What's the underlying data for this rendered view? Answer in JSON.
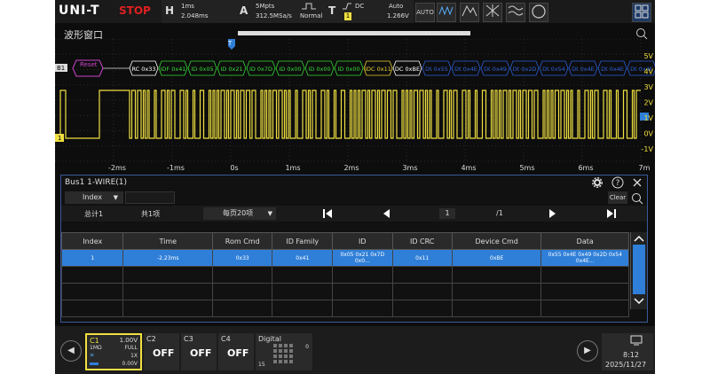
{
  "top": {
    "logo": "UNI-T",
    "status": "STOP",
    "h": {
      "letter": "H",
      "val1": "1ms",
      "val2": "2.048ms"
    },
    "a": {
      "letter": "A",
      "val1": "5Mpts",
      "val2": "312.5MSa/s",
      "mode": "Normal"
    },
    "t": {
      "letter": "T",
      "src": "DC",
      "lvl": "1",
      "mode": "Auto",
      "val": "1.266V"
    },
    "buttons": [
      "AUTO"
    ]
  },
  "wave": {
    "title": "波形窗口",
    "trig_marker": "T",
    "bus_label": "B1",
    "reset_label": "Reset",
    "packets": [
      {
        "text": "RC 0x33",
        "color": "#ffffff"
      },
      {
        "text": "IDF 0x41",
        "color": "#35d835"
      },
      {
        "text": "ID 0x05",
        "color": "#35d835"
      },
      {
        "text": "ID 0x21",
        "color": "#35d835"
      },
      {
        "text": "ID 0x7D",
        "color": "#35d835"
      },
      {
        "text": "ID 0x00",
        "color": "#35d835"
      },
      {
        "text": "ID 0x00",
        "color": "#35d835"
      },
      {
        "text": "ID 0x00",
        "color": "#35d835"
      },
      {
        "text": "IDC 0x11",
        "color": "#e8d030"
      },
      {
        "text": "DC 0xBE",
        "color": "#ffffff"
      },
      {
        "text": "Dt 0x55",
        "color": "#2a5ed8"
      },
      {
        "text": "Dt 0x4E",
        "color": "#2a5ed8"
      },
      {
        "text": "Dt 0x49",
        "color": "#2a5ed8"
      },
      {
        "text": "Dt 0x2D",
        "color": "#2a5ed8"
      },
      {
        "text": "Dt 0x54",
        "color": "#2a5ed8"
      },
      {
        "text": "Dt 0x4E",
        "color": "#2a5ed8"
      },
      {
        "text": "Dt 0x4E",
        "color": "#2a5ed8"
      },
      {
        "text": "Dt 0x4E",
        "color": "#2a5ed8"
      }
    ],
    "ch1_label": "1",
    "right_volts": [
      "5V",
      "4V",
      "3V",
      "2V",
      "1V",
      "0V",
      "-1V"
    ],
    "time_ticks": [
      "-2ms",
      "-1ms",
      "0s",
      "1ms",
      "2ms",
      "3ms",
      "4ms",
      "5ms",
      "6ms",
      "7m"
    ]
  },
  "panel": {
    "title": "Bus1 1-WIRE(1)",
    "filter_label": "Index",
    "clear": "Clear",
    "total": "总计1",
    "items": "共1项",
    "per_page": "每页20项",
    "page": "1",
    "of_pages": "/1",
    "columns": [
      "Index",
      "Time",
      "Rom Cmd",
      "ID Family",
      "ID",
      "ID CRC",
      "Device Cmd",
      "Data"
    ],
    "rows": [
      [
        "1",
        "-2.23ms",
        "0x33",
        "0x41",
        "0x05 0x21 0x7D 0x0...",
        "0x11",
        "0xBE",
        "0x55 0x4E 0x49 0x2D 0x54 0x4E..."
      ]
    ]
  },
  "bottom": {
    "c1": {
      "name": "C1",
      "volts": "1.00V",
      "imp": "1MΩ",
      "bw": "FULL",
      "probe": "1X",
      "offset": "0.00V"
    },
    "c2": {
      "name": "C2",
      "state": "OFF"
    },
    "c3": {
      "name": "C3",
      "state": "OFF"
    },
    "c4": {
      "name": "C4",
      "state": "OFF"
    },
    "digital": {
      "name": "Digital",
      "low": "15",
      "high": "0"
    },
    "time": "8:12",
    "date": "2025/11/27"
  },
  "colors": {
    "ch1": "#f0e040",
    "accent": "#2f7fd8"
  }
}
